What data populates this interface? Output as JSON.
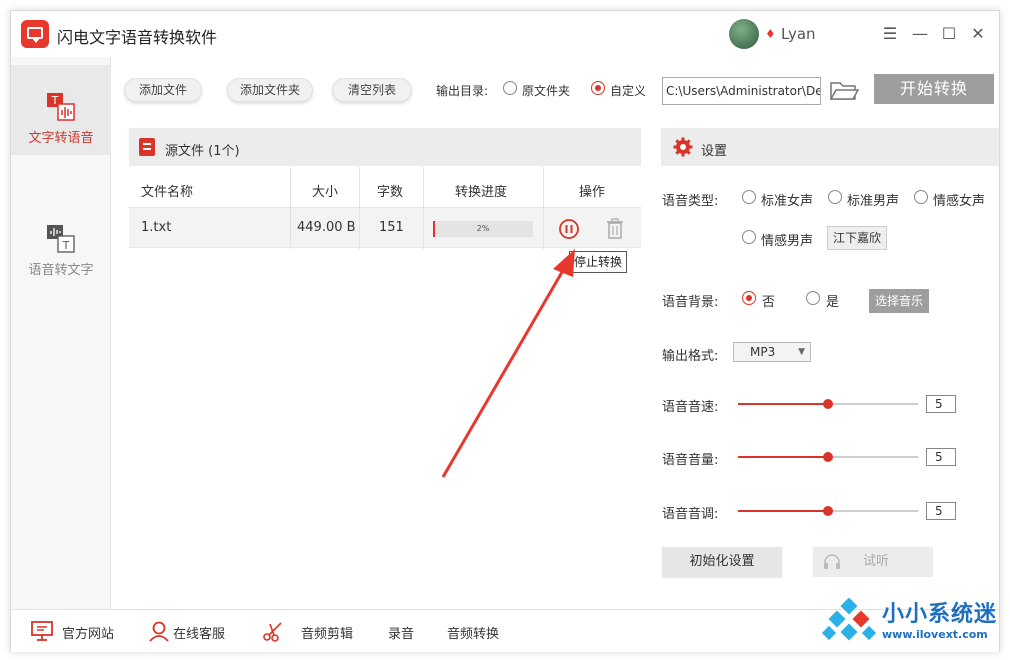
{
  "window": {
    "title": "闪电文字语音转换软件",
    "user": "Lyan",
    "controls": {
      "menu": "☰",
      "minimize": "—",
      "maximize": "☐",
      "close": "✕"
    }
  },
  "sidebar": {
    "items": [
      {
        "label": "文字转语音",
        "active": true
      },
      {
        "label": "语音转文字",
        "active": false
      }
    ]
  },
  "toolbar": {
    "add_file": "添加文件",
    "add_folder": "添加文件夹",
    "clear_list": "清空列表",
    "output_dir_label": "输出目录:",
    "option_source": "原文件夹",
    "option_custom": "自定义",
    "selected_option": "自定义",
    "output_path": "C:\\Users\\Administrator\\De",
    "start": "开始转换"
  },
  "file_panel": {
    "title": "源文件 (1个)",
    "columns": [
      "文件名称",
      "大小",
      "字数",
      "转换进度",
      "操作"
    ],
    "rows": [
      {
        "name": "1.txt",
        "size": "449.00 B",
        "chars": "151",
        "progress_text": "2%",
        "progress": 0.02
      }
    ],
    "tooltip": "停止转换"
  },
  "settings": {
    "title": "设置",
    "voice_type_label": "语音类型:",
    "voice_options": [
      "标准女声",
      "标准男声",
      "情感女声",
      "情感男声"
    ],
    "voice_name": "江下嘉欣",
    "bg_label": "语音背景:",
    "bg_no": "否",
    "bg_yes": "是",
    "bg_selected": "否",
    "choose_music": "选择音乐",
    "format_label": "输出格式:",
    "format_value": "MP3",
    "speed_label": "语音音速:",
    "speed_value": "5",
    "volume_label": "语音音量:",
    "volume_value": "5",
    "pitch_label": "语音音调:",
    "pitch_value": "5",
    "slider_level": 0.5,
    "reset": "初始化设置",
    "listen": "试听"
  },
  "footer": {
    "website": "官方网站",
    "support": "在线客服",
    "audio_edit": "音频剪辑",
    "record": "录音",
    "audio_convert": "音频转换"
  },
  "watermark": {
    "title": "小小系统迷",
    "url": "www.ilovext.com"
  },
  "colors": {
    "accent": "#d9342a",
    "gray_button": "#9e9e9e",
    "watermark_blue": "#1d6fc1"
  }
}
